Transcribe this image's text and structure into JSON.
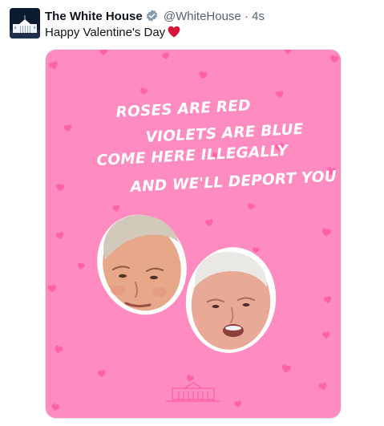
{
  "tweet": {
    "author": {
      "display_name": "The White House",
      "handle": "@WhiteHouse",
      "verified": true
    },
    "separator": "·",
    "timestamp": "4s",
    "text": "Happy Valentine's Day",
    "emoji": "red-heart-icon"
  },
  "card": {
    "poem": [
      "ROSES ARE RED",
      "VIOLETS ARE BLUE",
      "COME HERE ILLEGALLY",
      "AND WE'LL DEPORT YOU"
    ],
    "background_color": "#ff8cc0",
    "heart_color": "#ff5fa0",
    "emblem": "white-house-logo"
  },
  "colors": {
    "text_primary": "#0f1419",
    "text_secondary": "#536471",
    "verified_badge": "#829aab",
    "emoji_heart": "#d4153b"
  }
}
